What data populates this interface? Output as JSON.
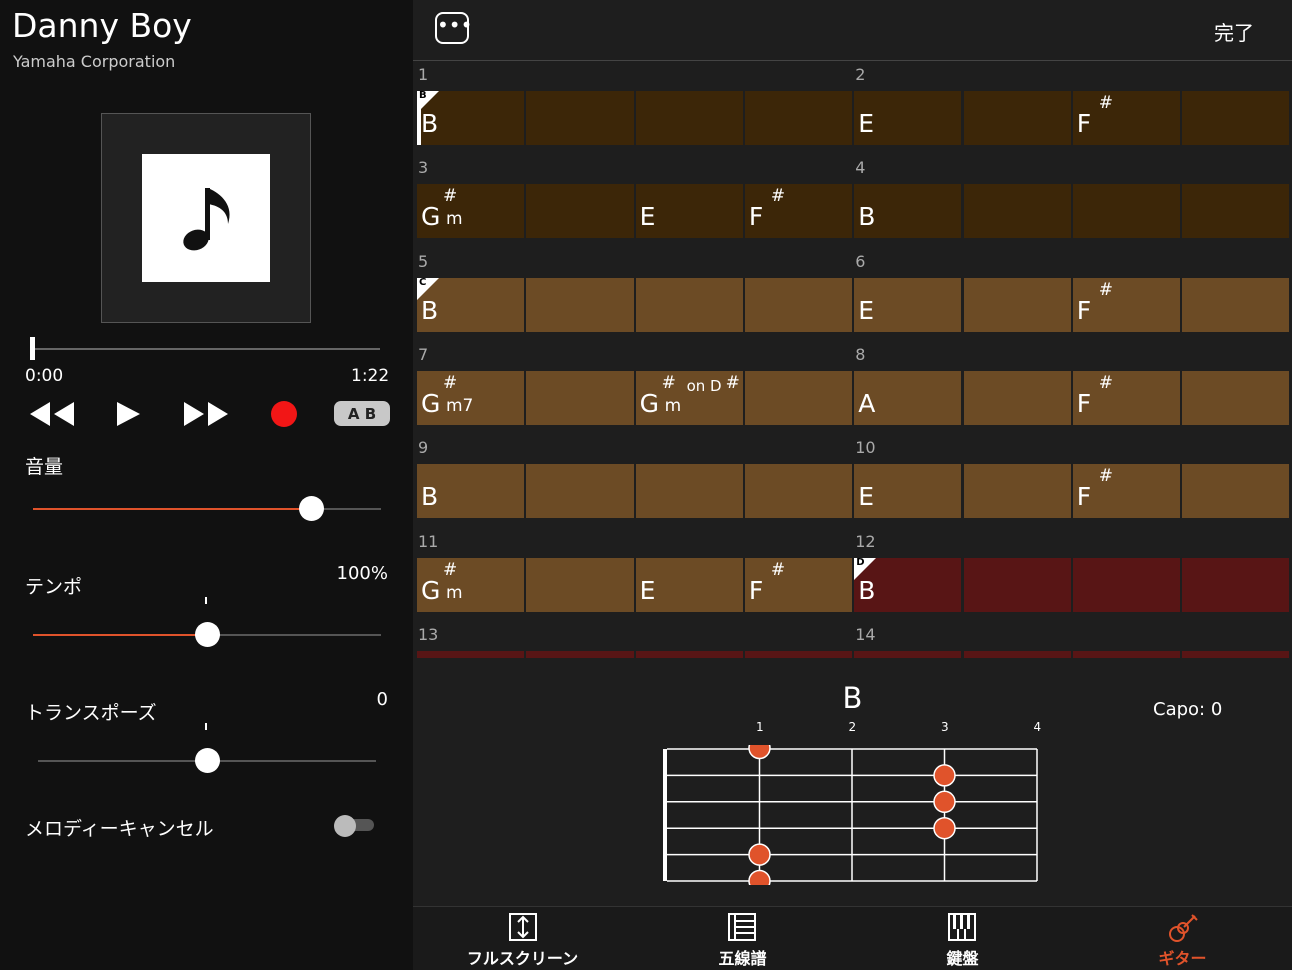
{
  "song": {
    "title": "Danny Boy",
    "artist": "Yamaha Corporation"
  },
  "player": {
    "current_time": "0:00",
    "total_time": "1:22",
    "ab_label": "A B",
    "progress": 0
  },
  "controls": {
    "volume": {
      "label": "音量",
      "level": 0.8
    },
    "tempo": {
      "label": "テンポ",
      "value": "100%",
      "level": 0.5
    },
    "transpose": {
      "label": "トランスポーズ",
      "value": "0",
      "level": 0.5
    },
    "melody_cancel": {
      "label": "メロディーキャンセル",
      "on": false
    }
  },
  "header": {
    "done_label": "完了"
  },
  "colors": {
    "dark": "#3c2608",
    "light": "#6c4b25",
    "active": "#581515",
    "accent": "#e0532b",
    "knob": "#ffffff"
  },
  "chord_rows": [
    {
      "bars": [
        "1",
        "2"
      ],
      "cells": [
        {
          "root": "B",
          "marker": "B",
          "cursor": true
        },
        {},
        {},
        {},
        {
          "root": "E"
        },
        {},
        {
          "root": "F",
          "acc": "#"
        },
        {}
      ],
      "shade": "dark"
    },
    {
      "bars": [
        "3",
        "4"
      ],
      "cells": [
        {
          "root": "G",
          "acc": "#",
          "qual": "m"
        },
        {},
        {
          "root": "E"
        },
        {
          "root": "F",
          "acc": "#"
        },
        {
          "root": "B"
        },
        {},
        {},
        {}
      ],
      "shade": "dark"
    },
    {
      "bars": [
        "5",
        "6"
      ],
      "cells": [
        {
          "root": "B",
          "marker": "C"
        },
        {},
        {},
        {},
        {
          "root": "E"
        },
        {},
        {
          "root": "F",
          "acc": "#"
        },
        {}
      ],
      "shade": "light"
    },
    {
      "bars": [
        "7",
        "8"
      ],
      "cells": [
        {
          "root": "G",
          "acc": "#",
          "qual": "m7"
        },
        {},
        {
          "root": "G",
          "acc": "#",
          "qual": "m",
          "on": "on D",
          "onacc": "#"
        },
        {},
        {
          "root": "A"
        },
        {},
        {
          "root": "F",
          "acc": "#"
        },
        {}
      ],
      "shade": "light"
    },
    {
      "bars": [
        "9",
        "10"
      ],
      "cells": [
        {
          "root": "B"
        },
        {},
        {},
        {},
        {
          "root": "E"
        },
        {},
        {
          "root": "F",
          "acc": "#"
        },
        {}
      ],
      "shade": "light"
    },
    {
      "bars": [
        "11",
        "12"
      ],
      "cells": [
        {
          "root": "G",
          "acc": "#",
          "qual": "m"
        },
        {},
        {
          "root": "E"
        },
        {
          "root": "F",
          "acc": "#"
        },
        {
          "root": "B",
          "marker": "D",
          "active": true
        },
        {
          "active": true
        },
        {
          "active": true
        },
        {
          "active": true
        }
      ],
      "shade": "light"
    },
    {
      "bars": [
        "13",
        "14"
      ],
      "cells": [],
      "shade": "active"
    }
  ],
  "diagram": {
    "chord": "B",
    "capo": "Capo: 0",
    "frets": [
      "1",
      "2",
      "3",
      "4"
    ],
    "dots": [
      {
        "string": 0,
        "fret": 1.5
      },
      {
        "string": 1,
        "fret": 3.5
      },
      {
        "string": 2,
        "fret": 3.5
      },
      {
        "string": 3,
        "fret": 3.5
      },
      {
        "string": 4,
        "fret": 1.5
      },
      {
        "string": 5,
        "fret": 1.5
      }
    ]
  },
  "nav": [
    {
      "label": "フルスクリーン",
      "icon": "fullscreen-icon",
      "active": false
    },
    {
      "label": "五線譜",
      "icon": "staff-icon",
      "active": false
    },
    {
      "label": "鍵盤",
      "icon": "keyboard-icon",
      "active": false
    },
    {
      "label": "ギター",
      "icon": "guitar-icon",
      "active": true
    }
  ]
}
